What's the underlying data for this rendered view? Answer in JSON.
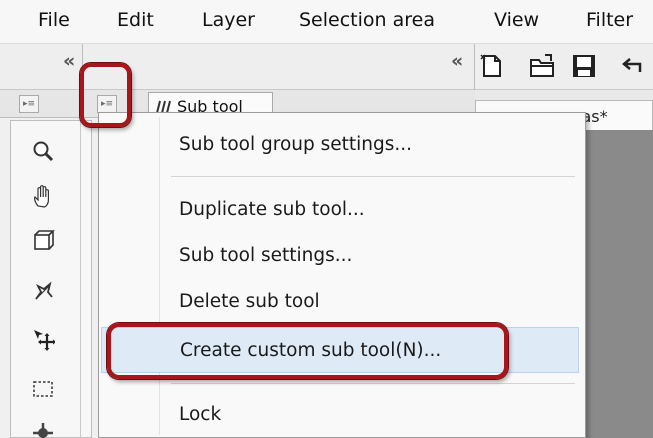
{
  "menubar": {
    "items": [
      "File",
      "Edit",
      "Layer",
      "Selection area",
      "View",
      "Filter"
    ]
  },
  "panel": {
    "subtool_tab_label": "Sub tool",
    "canvas_tab_label": "vas*"
  },
  "context_menu": {
    "items": [
      {
        "label": "Sub tool group settings..."
      },
      {
        "label": "Duplicate sub tool..."
      },
      {
        "label": "Sub tool settings..."
      },
      {
        "label": "Delete sub tool"
      },
      {
        "label": "Create custom sub tool(N)...",
        "highlighted": true
      },
      {
        "label": "Lock"
      }
    ]
  },
  "tools": [
    "zoom-icon",
    "hand-icon",
    "rotate-view-icon",
    "operation-icon",
    "move-layer-icon",
    "selection-icon",
    "gear-tool-icon"
  ],
  "colors": {
    "highlight_ring": "#a8161c",
    "hover_bg": "#dfeaf7",
    "canvas_gray": "#8a8a8a"
  }
}
